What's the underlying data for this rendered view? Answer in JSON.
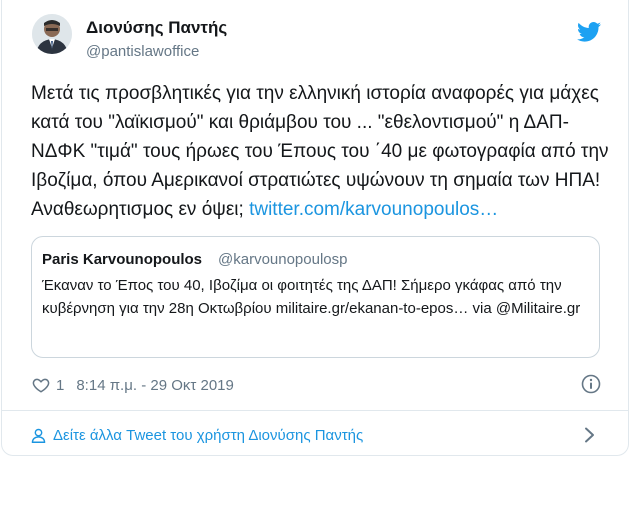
{
  "tweet": {
    "author_name": "Διονύσης Παντής",
    "author_handle": "@pantislawoffice",
    "text": "Μετά τις προσβλητικές για την ελληνική ιστορία αναφορές για μάχες κατά του \"λαϊκισμού\" και θριάμβου του ... \"εθελοντισμού\" η ΔΑΠ-ΝΔΦΚ \"τιμά\" τους ήρωες του Έπους του ΄40 με φωτογραφία από την Ιβοζίμα, όπου Αμερικανοί στρατιώτες υψώνουν τη σημαία των ΗΠΑ! Αναθεωρητισμος εν όψει; ",
    "link": "twitter.com/karvounopoulos…",
    "likes": "1",
    "timestamp": "8:14 π.μ. - 29 Οκτ 2019"
  },
  "quote": {
    "author_name": "Paris Karvounopoulos",
    "author_handle": "@karvounopoulosp",
    "text": "Έκαναν το Έπος του 40, Ιβοζίμα οι φοιτητές της ΔΑΠ! Σήμερο γκάφας από την κυβέρνηση για την 28η Οκτωβρίου militaire.gr/ekanan-to-epos… via @Militaire.gr"
  },
  "footer": {
    "more_tweets_label": "Δείτε άλλα Tweet του χρήστη Διονύσης Παντής"
  },
  "colors": {
    "accent": "#1b95e0",
    "secondary_text": "#657786",
    "border": "#e1e8ed"
  },
  "icons": [
    "twitter-bird-icon",
    "heart-icon",
    "info-icon",
    "person-icon",
    "chevron-right-icon"
  ]
}
